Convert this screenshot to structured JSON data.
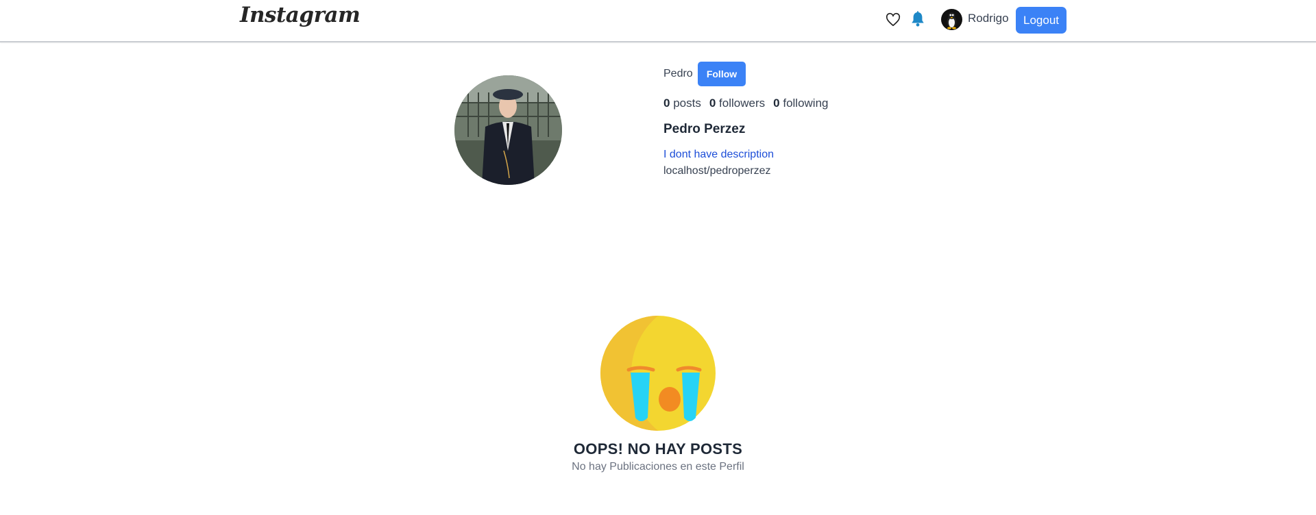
{
  "header": {
    "logo_text": "Instagram",
    "icons": [
      "heart-icon",
      "bell-icon"
    ],
    "user_name": "Rodrigo",
    "logout_label": "Logout"
  },
  "profile": {
    "username": "Pedro",
    "follow_label": "Follow",
    "stats": {
      "posts_count": "0",
      "posts_label": "posts",
      "followers_count": "0",
      "followers_label": "followers",
      "following_count": "0",
      "following_label": "following"
    },
    "full_name": "Pedro Perzez",
    "description": "I dont have description",
    "link": "localhost/pedroperzez"
  },
  "empty_state": {
    "title": "OOPS! NO HAY POSTS",
    "subtitle": "No hay Publicaciones en este Perfil"
  },
  "colors": {
    "accent": "#3b82f6",
    "description_link": "#1d4ed8",
    "emoji_yellow": "#f3d630",
    "tear_blue": "#27d3f5"
  }
}
